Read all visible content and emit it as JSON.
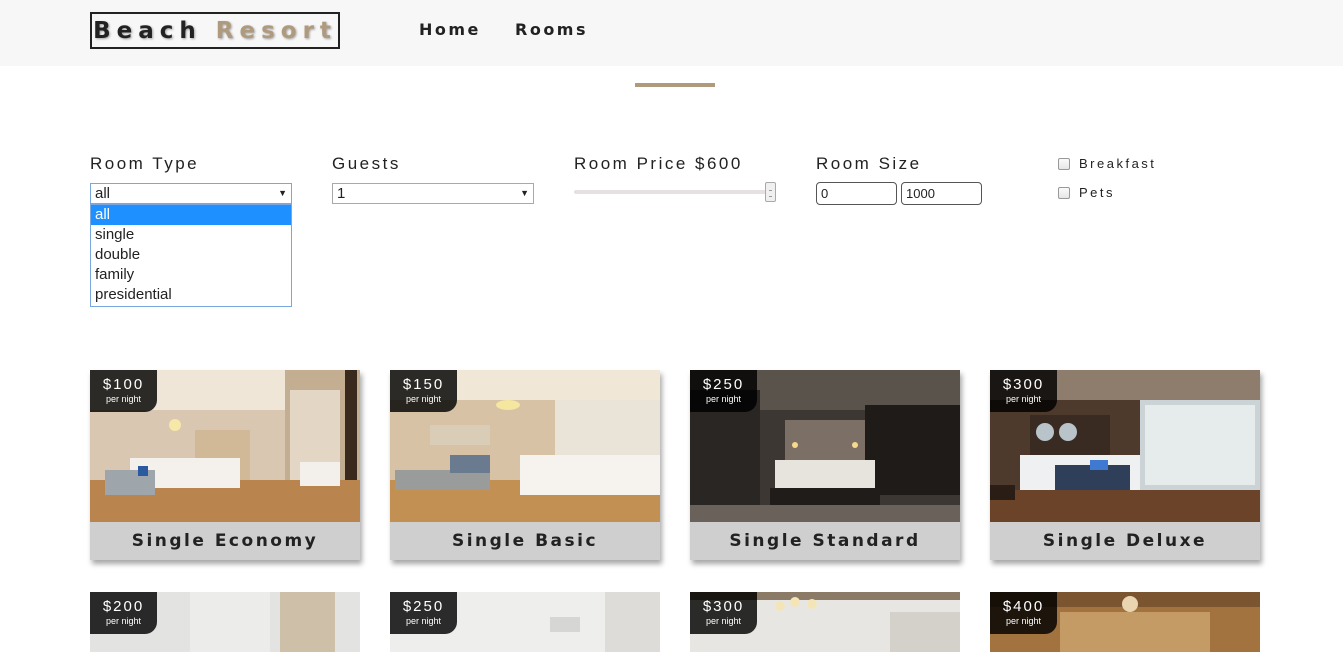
{
  "brand": {
    "word1": "Beach",
    "word2": "Resort"
  },
  "nav": {
    "home": "Home",
    "rooms": "Rooms"
  },
  "filters": {
    "room_type": {
      "label": "Room Type",
      "selected": "all",
      "options": [
        "all",
        "single",
        "double",
        "family",
        "presidential"
      ]
    },
    "guests": {
      "label": "Guests",
      "selected": "1"
    },
    "price": {
      "label": "Room Price $600",
      "max": 600
    },
    "size": {
      "label": "Room Size",
      "min": "0",
      "max": "1000"
    },
    "breakfast": {
      "label": "Breakfast",
      "checked": false
    },
    "pets": {
      "label": "Pets",
      "checked": false
    }
  },
  "per_night_label": "per night",
  "rooms": [
    {
      "name": "Single Economy",
      "price": "$100"
    },
    {
      "name": "Single Basic",
      "price": "$150"
    },
    {
      "name": "Single Standard",
      "price": "$250"
    },
    {
      "name": "Single Deluxe",
      "price": "$300"
    },
    {
      "name": "",
      "price": "$200"
    },
    {
      "name": "",
      "price": "$250"
    },
    {
      "name": "",
      "price": "$300"
    },
    {
      "name": "",
      "price": "$400"
    }
  ],
  "colors": {
    "accent": "#af9a7d",
    "nav_bg": "#f7f7f7",
    "card_footer": "#cfcfcf",
    "select_highlight": "#1e90ff"
  }
}
